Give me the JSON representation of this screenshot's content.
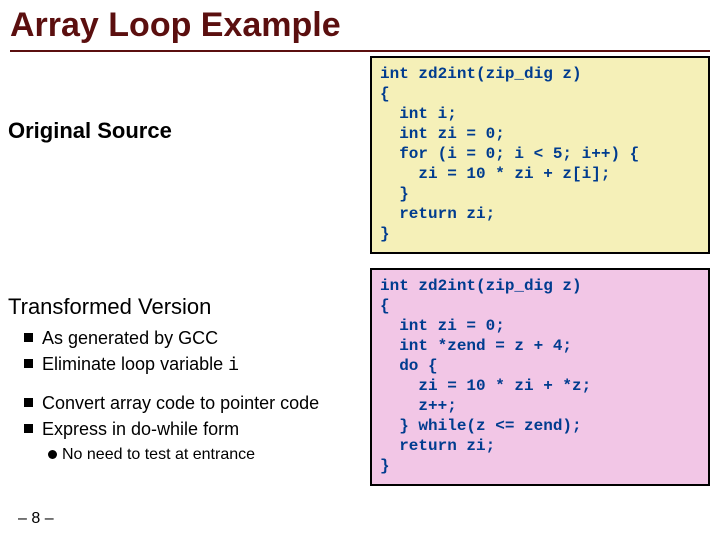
{
  "title": "Array Loop Example",
  "leftHeading1": "Original Source",
  "leftHeading2": "Transformed Version",
  "bullets": {
    "b1": "As generated by GCC",
    "b2_pre": "Eliminate loop variable ",
    "b2_code": "i",
    "b3": "Convert array code to pointer code",
    "b4": "Express in do-while form",
    "b4a": "No need to test at entrance"
  },
  "code1": "int zd2int(zip_dig z)\n{\n  int i;\n  int zi = 0;\n  for (i = 0; i < 5; i++) {\n    zi = 10 * zi + z[i];\n  }\n  return zi;\n}",
  "code2": "int zd2int(zip_dig z)\n{\n  int zi = 0;\n  int *zend = z + 4;\n  do {\n    zi = 10 * zi + *z;\n    z++;\n  } while(z <= zend);\n  return zi;\n}",
  "pageNum": "– 8 –"
}
